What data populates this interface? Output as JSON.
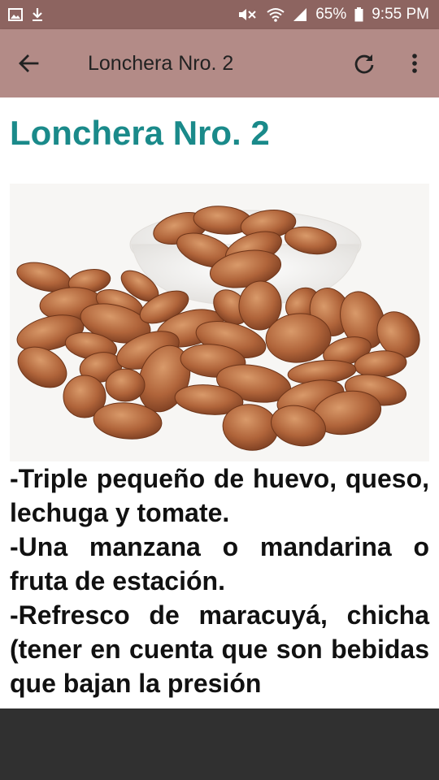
{
  "status_bar": {
    "battery": "65%",
    "time": "9:55 PM",
    "icons": [
      "image-icon",
      "download-icon",
      "mute-icon",
      "wifi-icon",
      "signal-icon",
      "battery-icon"
    ]
  },
  "app_bar": {
    "title": "Lonchera Nro. 2",
    "icons": [
      "back-arrow-icon",
      "refresh-icon",
      "more-vert-icon"
    ],
    "color": "#b38b87"
  },
  "content": {
    "heading": "Lonchera Nro. 2",
    "heading_color": "#1a8a8a",
    "image_subject": "almonds",
    "paragraphs": [
      "-Triple pequeño de huevo, queso, lechuga y tomate.",
      "-Una manzana o mandarina o fruta de estación.",
      "-Refresco de maracuyá, chicha (tener en cuenta que son bebidas que bajan la presión"
    ]
  }
}
